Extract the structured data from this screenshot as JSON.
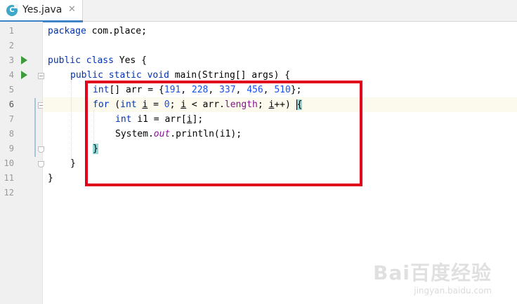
{
  "tab": {
    "title": "Yes.java",
    "close_icon": "close-icon",
    "file_icon": "java-class-icon",
    "file_icon_letter": "C"
  },
  "gutter": {
    "line_numbers": [
      "1",
      "2",
      "3",
      "4",
      "5",
      "6",
      "7",
      "8",
      "9",
      "10",
      "11",
      "12"
    ]
  },
  "code": {
    "l1": [
      "package",
      " com.place;"
    ],
    "l3": [
      "public",
      " ",
      "class",
      " Yes {"
    ],
    "l4": [
      "public",
      " ",
      "static",
      " ",
      "void",
      " main(String[] args) {"
    ],
    "l5": [
      "int",
      "[] arr = {",
      "191",
      ", ",
      "228",
      ", ",
      "337",
      ", ",
      "456",
      ", ",
      "510",
      "};"
    ],
    "l6": [
      "for",
      " (",
      "int",
      " ",
      "i",
      " = ",
      "0",
      "; ",
      "i",
      " < arr.",
      "length",
      "; ",
      "i",
      "++) ",
      "{"
    ],
    "l7": [
      "int",
      " i1 = arr[",
      "i",
      "];"
    ],
    "l8": [
      "System.",
      "out",
      ".println(i1);"
    ],
    "l9": [
      "}"
    ],
    "l10": [
      "}"
    ],
    "l11": [
      "}"
    ]
  },
  "colors": {
    "keyword": "#0033b3",
    "number": "#1750eb",
    "field": "#871094",
    "highlight_box": "#e1001c"
  },
  "watermark": {
    "logo": "Bai百度经验",
    "url": "jingyan.baidu.com"
  }
}
